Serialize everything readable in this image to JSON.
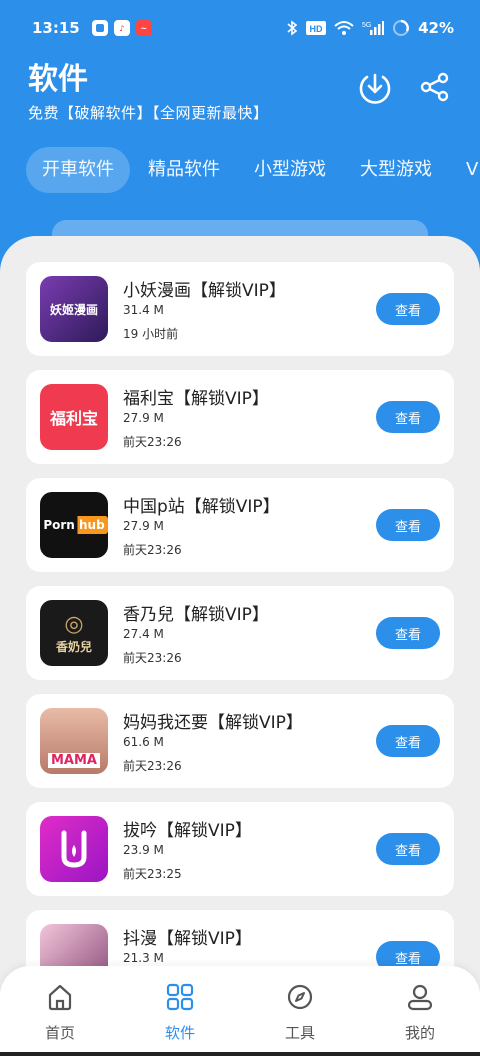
{
  "status_bar": {
    "time": "13:15",
    "network": "5G",
    "battery": "42%"
  },
  "header": {
    "title": "软件",
    "subtitle": "免费【破解软件】【全网更新最快】"
  },
  "tabs": [
    {
      "label": "开車软件"
    },
    {
      "label": "精品软件"
    },
    {
      "label": "小型游戏"
    },
    {
      "label": "大型游戏"
    },
    {
      "label": "V"
    }
  ],
  "apps": [
    {
      "name": "小妖漫画【解锁VIP】",
      "size": "31.4 M",
      "time": "19 小时前",
      "button": "查看",
      "icon_text": "妖姬漫画",
      "icon_color": "#5A2A8A"
    },
    {
      "name": "福利宝【解锁VIP】",
      "size": "27.9 M",
      "time": "前天23:26",
      "button": "查看",
      "icon_text": "福利宝",
      "icon_color": "#F03A50"
    },
    {
      "name": "中国p站【解锁VIP】",
      "size": "27.9 M",
      "time": "前天23:26",
      "button": "查看",
      "icon_text": "Porn hub",
      "icon_color": "#111111"
    },
    {
      "name": "香乃兒【解锁VIP】",
      "size": "27.4 M",
      "time": "前天23:26",
      "button": "查看",
      "icon_text": "香奶兒",
      "icon_color": "#1A1A1A"
    },
    {
      "name": "妈妈我还要【解锁VIP】",
      "size": "61.6 M",
      "time": "前天23:26",
      "button": "查看",
      "icon_text": "MAMA",
      "icon_color": "#D9A48C"
    },
    {
      "name": "拔吟【解锁VIP】",
      "size": "23.9 M",
      "time": "前天23:25",
      "button": "查看",
      "icon_text": "",
      "icon_color": "#C020C8"
    },
    {
      "name": "抖漫【解锁VIP】",
      "size": "21.3 M",
      "time": "",
      "button": "查看",
      "icon_text": "",
      "icon_color": "#C98AA8"
    }
  ],
  "bottom_nav": [
    {
      "label": "首页",
      "icon": "home-icon"
    },
    {
      "label": "软件",
      "icon": "grid-icon"
    },
    {
      "label": "工具",
      "icon": "compass-icon"
    },
    {
      "label": "我的",
      "icon": "user-icon"
    }
  ],
  "colors": {
    "accent": "#2C8FEA",
    "panel_bg": "#EEEEEE"
  }
}
